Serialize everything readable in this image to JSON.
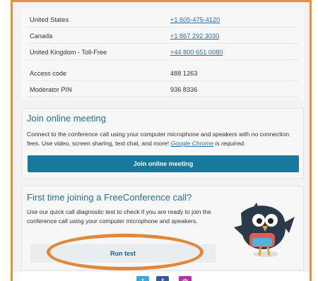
{
  "numbers": [
    {
      "country": "United States",
      "number": "+1 605-475-4120"
    },
    {
      "country": "Canada",
      "number": "+1 867 292 3030"
    },
    {
      "country": "United Kingdom - Toll-Free",
      "number": "+44 800 651 0080"
    }
  ],
  "access": {
    "code_label": "Access code",
    "code_value": "488 1263",
    "pin_label": "Moderator PIN",
    "pin_value": "936 8336"
  },
  "join": {
    "title": "Join online meeting",
    "desc_part1": "Connect to the conference call using your computer microphone and speakers with no connection fees. Use video, screen sharing, text chat, and more! ",
    "desc_link": "Google Chrome",
    "desc_part2": " is required.",
    "button": "Join online meeting"
  },
  "test": {
    "title": "First time joining a FreeConference call?",
    "desc": "Use our quick call diagnostic test to check if you are ready to join the conference call using your computer microphone and speakers.",
    "button": "Run test"
  },
  "colors": {
    "accent_border": "#e8913a",
    "primary_button": "#17799c",
    "link": "#2a6fb0",
    "heading": "#2a6f9c"
  },
  "icons": [
    "twitter-icon",
    "facebook-icon",
    "instagram-icon"
  ]
}
